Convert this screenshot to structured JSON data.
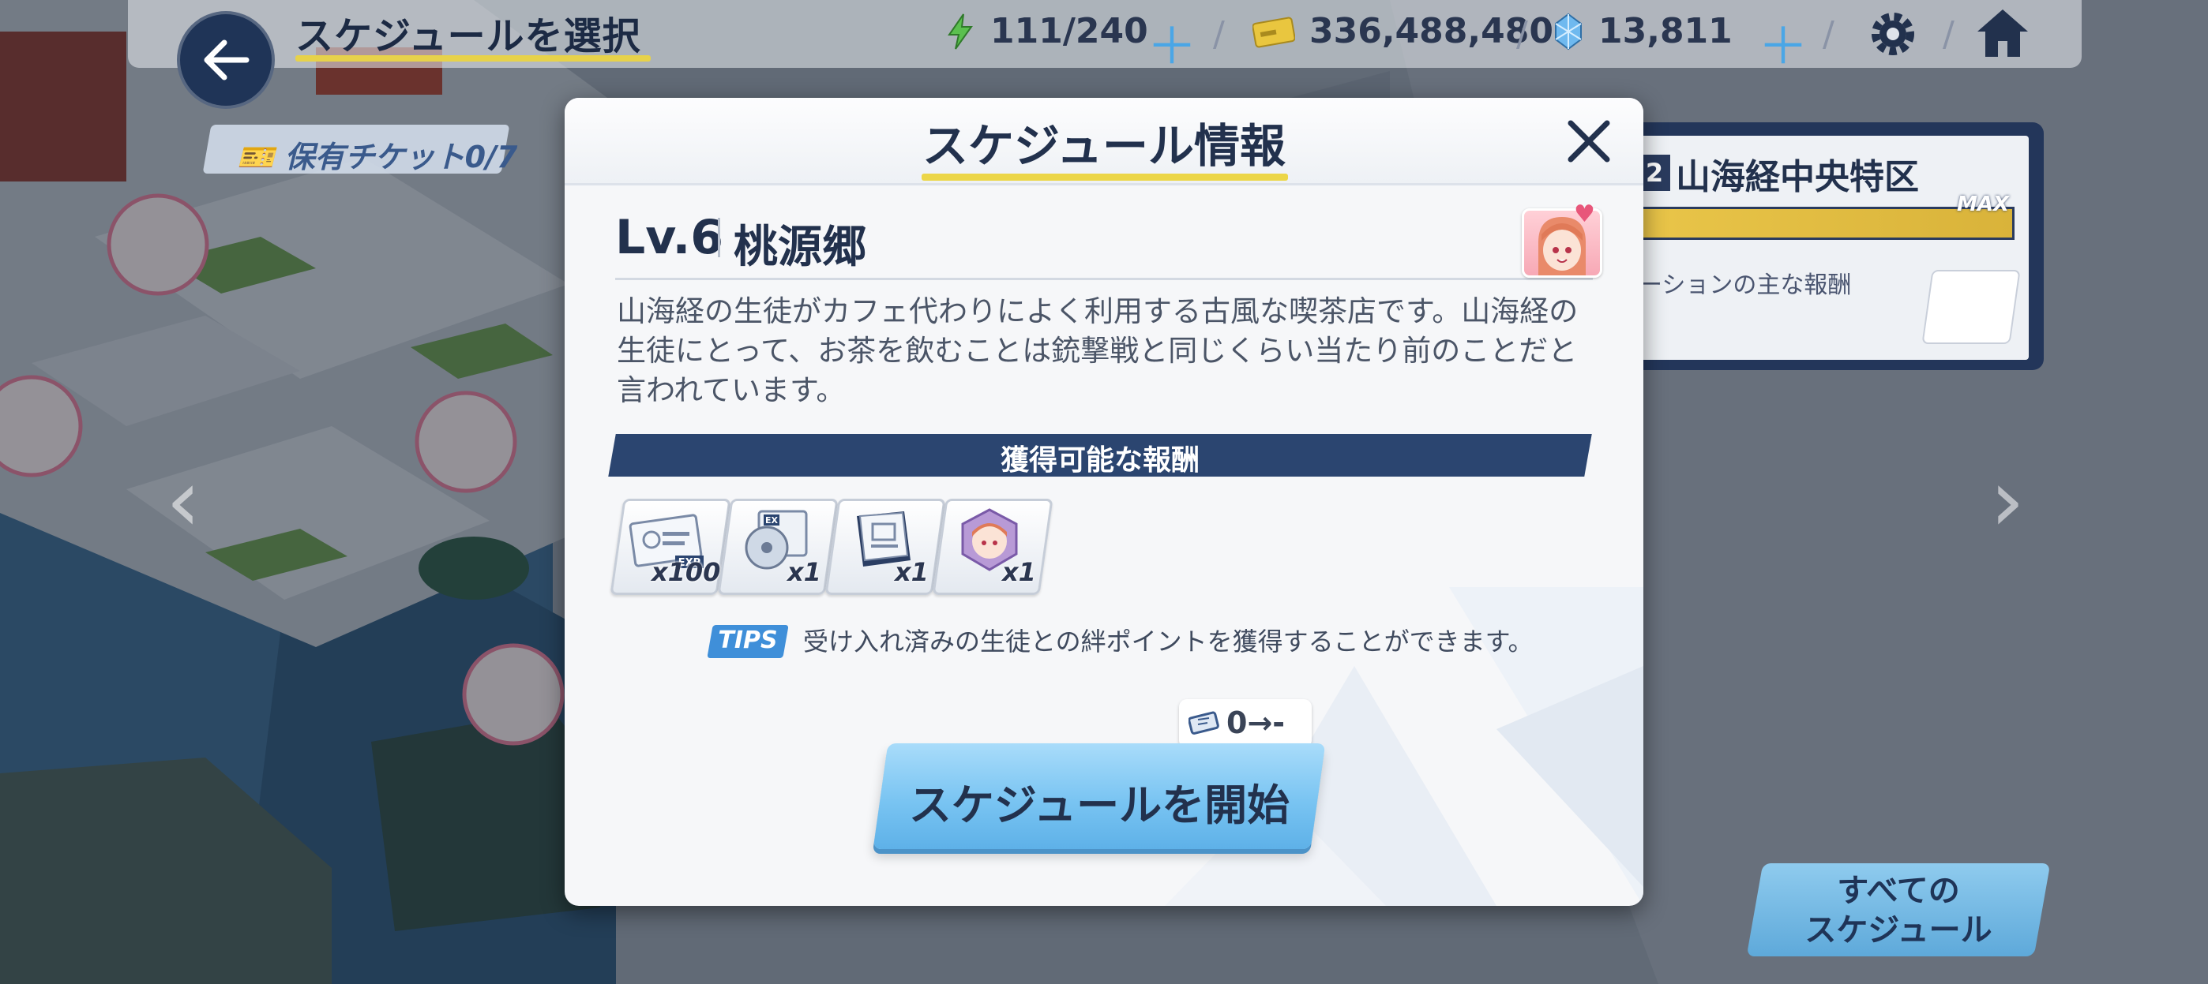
{
  "topbar": {
    "title": "スケジュールを選択",
    "ap": "111/240",
    "credits": "336,488,480",
    "gems": "13,811",
    "separator": "/",
    "plus": "＋",
    "icons": [
      "back-arrow-icon",
      "lightning-icon",
      "credit-card-icon",
      "gem-icon",
      "gear-icon",
      "home-icon"
    ]
  },
  "left_chip": {
    "label": "保有チケット",
    "count": "0/7"
  },
  "side_panel": {
    "badge": "2",
    "title": "山海経中央特区",
    "max_label": "MAX",
    "subtitle": "ーションの主な報酬"
  },
  "all_schedules_button": "すべての\nスケジュール",
  "modal": {
    "title": "スケジュール情報",
    "level": "Lv.6",
    "location": "桃源郷",
    "description": "山海経の生徒がカフェ代わりによく利用する古風な喫茶店です。山海経の生徒にとって、お茶を飲むことは銃撃戦と同じくらい当たり前のことだと言われています。",
    "rewards_header": "獲得可能な報酬",
    "rewards": [
      {
        "icon": "exp-report-icon",
        "qty": "x100",
        "tag": "EXP"
      },
      {
        "icon": "ex-disc-icon",
        "qty": "x1",
        "tag": "EX"
      },
      {
        "icon": "tech-notes-icon",
        "qty": "x1",
        "tag": ""
      },
      {
        "icon": "student-eleph-icon",
        "qty": "x1",
        "tag": ""
      }
    ],
    "tips_label": "TIPS",
    "tips_text": "受け入れ済みの生徒との絆ポイントを獲得することができます。",
    "cost": "0",
    "cost_after": "-",
    "start_button": "スケジュールを開始"
  },
  "colors": {
    "navy": "#23365a",
    "accent_yellow": "#ecd648",
    "button_blue": "#79c4f2",
    "tips_blue": "#3f8fd9"
  }
}
